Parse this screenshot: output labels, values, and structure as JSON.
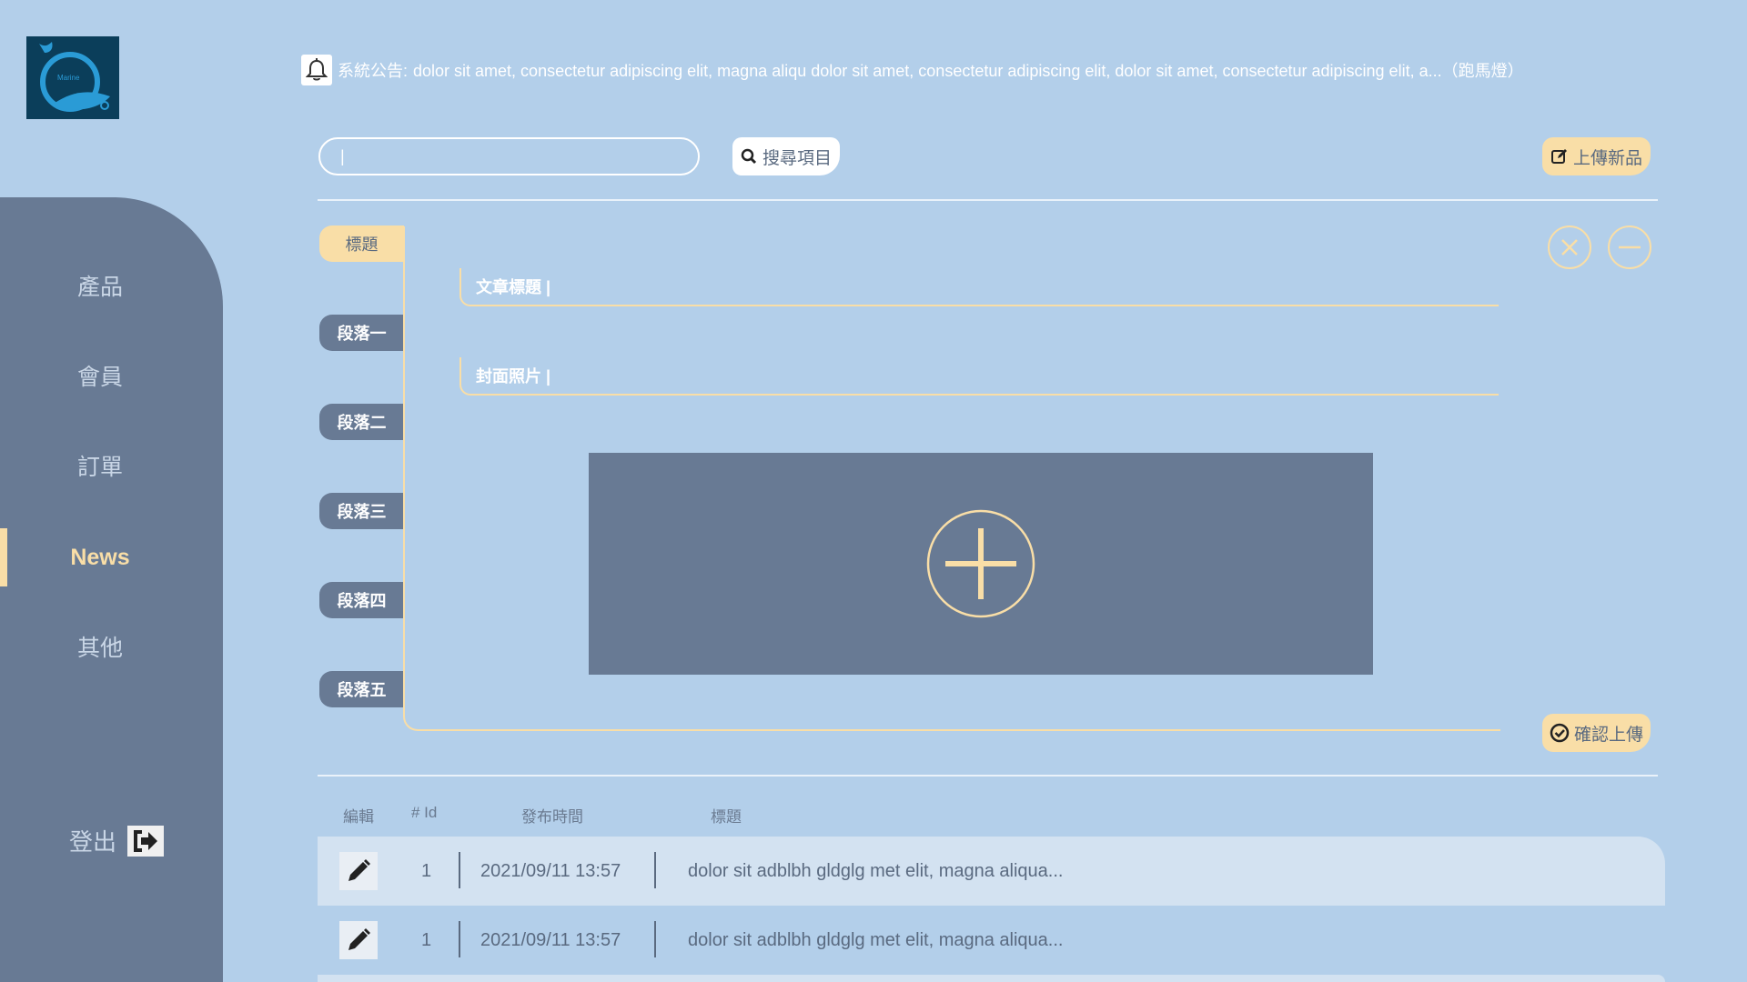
{
  "logo": {
    "text": "Marine"
  },
  "sidebar": {
    "items": [
      {
        "label": "產品"
      },
      {
        "label": "會員"
      },
      {
        "label": "訂單"
      },
      {
        "label": "News"
      },
      {
        "label": "其他"
      }
    ],
    "active": "News",
    "logout_label": "登出"
  },
  "header": {
    "announcement_label": "系統公告:",
    "announcement_text": "dolor sit amet, consectetur adipiscing elit, magna aliqu dolor sit amet, consectetur adipiscing elit, dolor sit amet, consectetur adipiscing elit, a...（跑馬燈）"
  },
  "search": {
    "placeholder": "|",
    "button_label": "搜尋項目"
  },
  "upload_new_label": "上傳新品",
  "editor": {
    "tabs": [
      {
        "label": "標題"
      },
      {
        "label": "段落一"
      },
      {
        "label": "段落二"
      },
      {
        "label": "段落三"
      },
      {
        "label": "段落四"
      },
      {
        "label": "段落五"
      }
    ],
    "active_tab": "標題",
    "title_field": "文章標題 |",
    "cover_field": "封面照片 |",
    "confirm_label": "確認上傳"
  },
  "table": {
    "headers": [
      "編輯",
      "# Id",
      "發布時間",
      "標題"
    ],
    "rows": [
      {
        "id": "1",
        "date": "2021/09/11 13:57",
        "title": "dolor sit adblbh gldglg met elit, magna aliqua..."
      },
      {
        "id": "1",
        "date": "2021/09/11 13:57",
        "title": "dolor sit adblbh gldglg met elit, magna aliqua..."
      }
    ]
  },
  "colors": {
    "background": "#b3cfea",
    "sidebar": "#687a94",
    "accent": "#f9dea7",
    "text_muted": "#5a6a80"
  }
}
